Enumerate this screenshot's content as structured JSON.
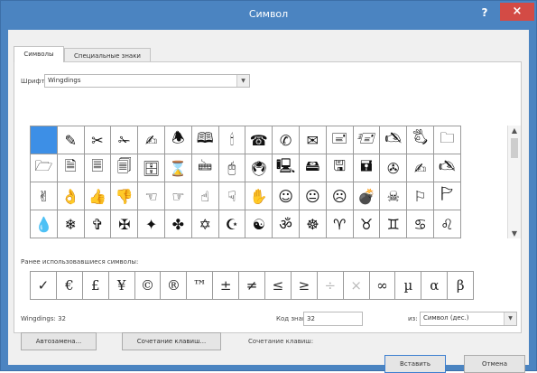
{
  "window": {
    "title": "Символ",
    "help": "?",
    "close": "×"
  },
  "tabs": [
    {
      "label": "Символы"
    },
    {
      "label": "Специальные знаки"
    }
  ],
  "font": {
    "label": "Шрифт:",
    "value": "Wingdings"
  },
  "grid": {
    "rows": [
      [
        "",
        "✎",
        "✂",
        "✁",
        "✍",
        "🕭",
        "🕮",
        "🕯",
        "☎",
        "✆",
        "✉",
        "🖃",
        "🖅",
        "🖎",
        "🖏",
        "🗀"
      ],
      [
        "🗁",
        "🗎",
        "🗏",
        "🗐",
        "🗄",
        "⌛",
        "🖮",
        "🖰",
        "🖲",
        "🖳",
        "🖴",
        "🖫",
        "🖬",
        "✇",
        "✍",
        "🖎"
      ],
      [
        "✌",
        "👌",
        "👍",
        "👎",
        "☜",
        "☞",
        "☝",
        "☟",
        "✋",
        "☺",
        "😐",
        "☹",
        "💣",
        "☠",
        "⚐",
        "🏱"
      ],
      [
        "💧",
        "❄",
        "✞",
        "✠",
        "✦",
        "✤",
        "✡",
        "☪",
        "☯",
        "ॐ",
        "☸",
        "♈",
        "♉",
        "♊",
        "♋",
        "♌",
        "♍"
      ]
    ]
  },
  "recent": {
    "label": "Ранее использовавшиеся символы:",
    "symbols": [
      "✓",
      "€",
      "£",
      "¥",
      "©",
      "®",
      "™",
      "±",
      "≠",
      "≤",
      "≥",
      "÷",
      "×",
      "∞",
      "µ",
      "α",
      "β"
    ]
  },
  "info": {
    "char_name": "Wingdings: 32",
    "code_label": "Код знака:",
    "code_value": "32",
    "from_label": "из:",
    "from_value": "Символ (дес.)",
    "shortcut_label": "Сочетание клавиш:"
  },
  "buttons": {
    "autocorrect": "Автозамена...",
    "shortcut_key": "Сочетание клавиш...",
    "insert": "Вставить",
    "cancel": "Отмена"
  },
  "colors": {
    "titlebar": "#4b84c1",
    "close": "#d34b45",
    "selection": "#3d8fe6"
  }
}
